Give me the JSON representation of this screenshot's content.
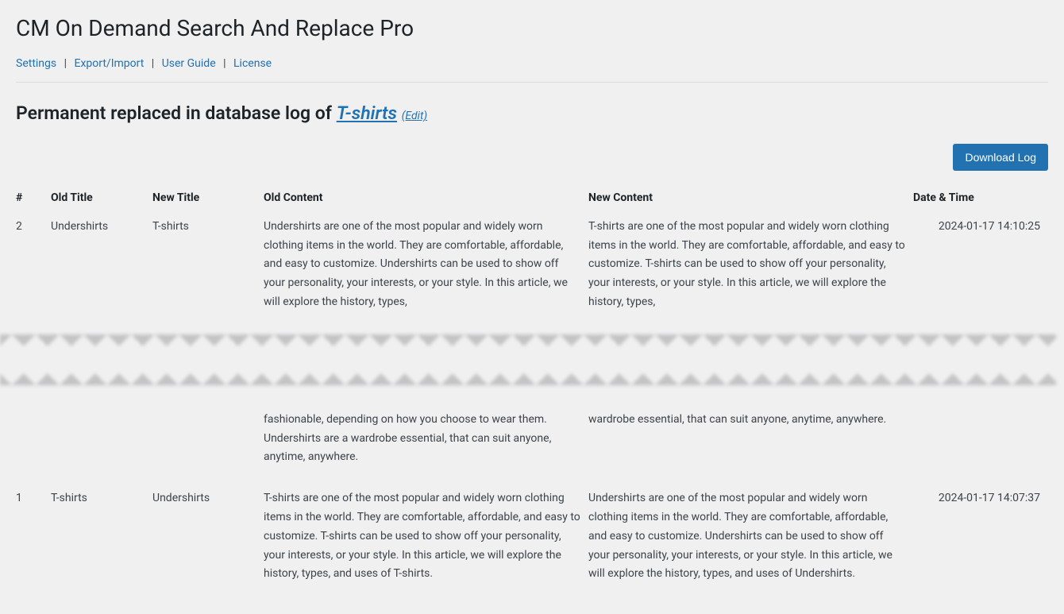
{
  "page": {
    "title": "CM On Demand Search And Replace Pro"
  },
  "nav": {
    "settings": "Settings",
    "export_import": "Export/Import",
    "user_guide": "User Guide",
    "license": "License"
  },
  "section": {
    "prefix": "Permanent replaced in database log of ",
    "term": "T-shirts",
    "edit": "(Edit)"
  },
  "actions": {
    "download_log": "Download Log"
  },
  "columns": {
    "num": "#",
    "old_title": "Old Title",
    "new_title": "New Title",
    "old_content": "Old Content",
    "new_content": "New Content",
    "date_time": "Date & Time"
  },
  "rows": [
    {
      "num": "2",
      "old_title": "Undershirts",
      "new_title": "T-shirts",
      "old_content_top": "Undershirts are one of the most popular and widely worn clothing items in the world. They are comfortable, affordable, and easy to customize. Undershirts can be used to show off your personality, your interests, or your style. In this article, we will explore the history, types,",
      "new_content_top": "T-shirts are one of the most popular and widely worn clothing items in the world. They are comfortable, affordable, and easy to customize. T-shirts can be used to show off your personality, your interests, or your style. In this article, we will explore the history, types,",
      "old_content_bottom": "fashionable, depending on how you choose to wear them. Undershirts are a wardrobe essential, that can suit anyone, anytime, anywhere.",
      "new_content_bottom": "wardrobe essential, that can suit anyone, anytime, anywhere.",
      "date": "2024-01-17 14:10:25"
    },
    {
      "num": "1",
      "old_title": "T-shirts",
      "new_title": "Undershirts",
      "old_content_top": "T-shirts are one of the most popular and widely worn clothing items in the world. They are comfortable, affordable, and easy to customize. T-shirts can be used to show off your personality, your interests, or your style. In this article, we will explore the history, types, and uses of T-shirts.",
      "new_content_top": "Undershirts are one of the most popular and widely worn clothing items in the world. They are comfortable, affordable, and easy to customize. Undershirts can be used to show off your personality, your interests, or your style. In this article, we will explore the history, types, and uses of Undershirts.",
      "date": "2024-01-17 14:07:37"
    }
  ]
}
